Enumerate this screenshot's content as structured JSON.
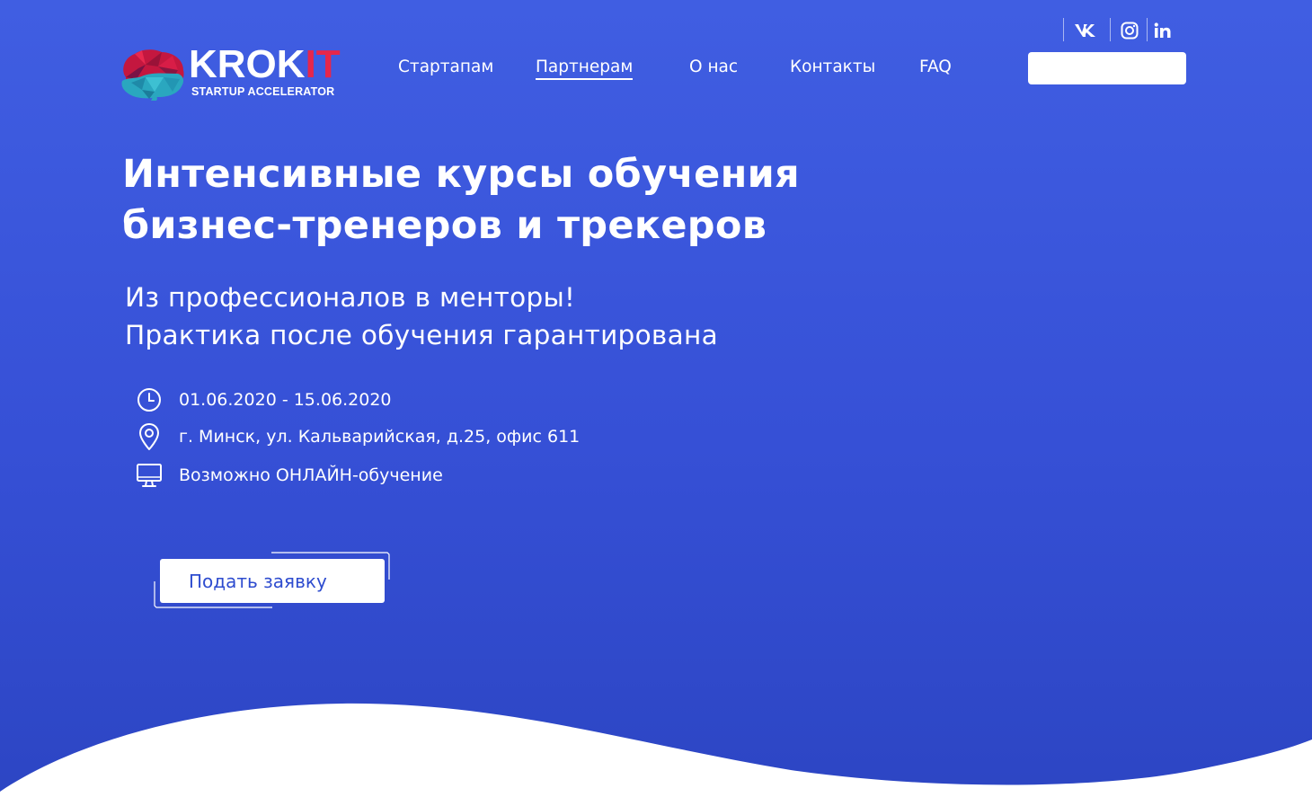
{
  "brand": {
    "name_main": "KROK",
    "name_accent": "IT",
    "tagline": "STARTUP ACCELERATOR",
    "accent_color": "#e6264b"
  },
  "nav": {
    "items": [
      {
        "label": "Стартапам",
        "active": false
      },
      {
        "label": "Партнерам",
        "active": true
      },
      {
        "label": "О нас",
        "active": false
      },
      {
        "label": "Контакты",
        "active": false
      },
      {
        "label": "FAQ",
        "active": false
      }
    ]
  },
  "social": [
    {
      "icon": "vk-icon"
    },
    {
      "icon": "instagram-icon"
    },
    {
      "icon": "linkedin-icon"
    }
  ],
  "hero": {
    "title_line1": "Интенсивные курсы обучения",
    "title_line2": "бизнес-тренеров и трекеров",
    "subtitle_line1": "Из профессионалов в менторы!",
    "subtitle_line2": "Практика после обучения гарантирована",
    "info": [
      {
        "icon": "clock-icon",
        "text": "01.06.2020 - 15.06.2020"
      },
      {
        "icon": "location-pin-icon",
        "text": "г. Минск, ул. Кальварийская, д.25, офис 611"
      },
      {
        "icon": "monitor-icon",
        "text": "Возможно ОНЛАЙН-обучение"
      }
    ],
    "cta_label": "Подать заявку"
  },
  "colors": {
    "hero_blue": "#3a56dc",
    "button_text": "#2e4ccf",
    "white": "#ffffff"
  }
}
